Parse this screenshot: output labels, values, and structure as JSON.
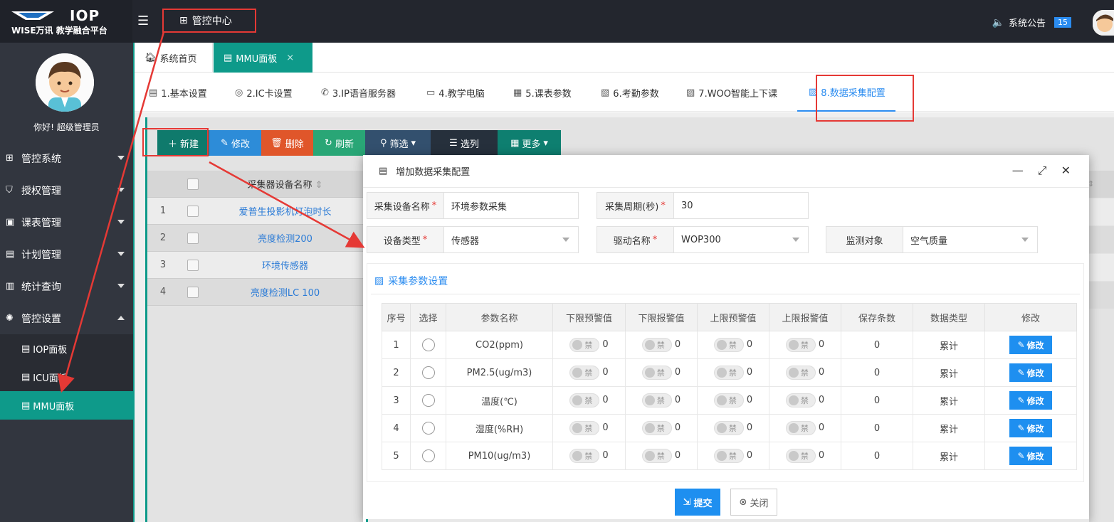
{
  "header": {
    "logo_title": "IOP",
    "logo_sub": "WISE万讯 教学融合平台",
    "center_label": "管控中心",
    "notice_label": "系统公告",
    "notice_count": "15"
  },
  "sidebar": {
    "greeting": "你好! 超级管理员",
    "items": [
      {
        "label": "管控系统"
      },
      {
        "label": "授权管理"
      },
      {
        "label": "课表管理"
      },
      {
        "label": "计划管理"
      },
      {
        "label": "统计查询"
      },
      {
        "label": "管控设置"
      }
    ],
    "subitems": [
      {
        "label": "IOP面板"
      },
      {
        "label": "ICU面板"
      },
      {
        "label": "MMU面板"
      }
    ]
  },
  "tabs": {
    "home": "系统首页",
    "mmu": "MMU面板",
    "close_glyph": "×"
  },
  "subtabs": [
    {
      "label": "1.基本设置"
    },
    {
      "label": "2.IC卡设置"
    },
    {
      "label": "3.IP语音服务器"
    },
    {
      "label": "4.教学电脑"
    },
    {
      "label": "5.课表参数"
    },
    {
      "label": "6.考勤参数"
    },
    {
      "label": "7.WOO智能上下课"
    },
    {
      "label": "8.数据采集配置"
    }
  ],
  "toolbar": {
    "new": "新建",
    "edit": "修改",
    "delete": "删除",
    "refresh": "刷新",
    "filter": "筛选",
    "columns": "选列",
    "more": "更多"
  },
  "grid": {
    "header_name": "采集器设备名称",
    "rows": [
      {
        "idx": "1",
        "name": "爱普生投影机灯泡时长"
      },
      {
        "idx": "2",
        "name": "亮度检测200"
      },
      {
        "idx": "3",
        "name": "环境传感器"
      },
      {
        "idx": "4",
        "name": "亮度检测LC 100"
      }
    ]
  },
  "modal": {
    "title": "增加数据采集配置",
    "fields": {
      "device_name_label": "采集设备名称",
      "device_name_value": "环境参数采集",
      "period_label": "采集周期(秒)",
      "period_value": "30",
      "device_type_label": "设备类型",
      "device_type_value": "传感器",
      "driver_label": "驱动名称",
      "driver_value": "WOP300",
      "target_label": "监测对象",
      "target_value": "空气质量"
    },
    "section_title": "采集参数设置",
    "columns": [
      "序号",
      "选择",
      "参数名称",
      "下限预警值",
      "下限报警值",
      "上限预警值",
      "上限报警值",
      "保存条数",
      "数据类型",
      "修改"
    ],
    "switch_text": "禁",
    "edit_label": "修改",
    "params": [
      {
        "idx": "1",
        "name": "CO2(ppm)",
        "ll_warn": "0",
        "ll_alarm": "0",
        "ul_warn": "0",
        "ul_alarm": "0",
        "keep": "0",
        "type": "累计"
      },
      {
        "idx": "2",
        "name": "PM2.5(ug/m3)",
        "ll_warn": "0",
        "ll_alarm": "0",
        "ul_warn": "0",
        "ul_alarm": "0",
        "keep": "0",
        "type": "累计"
      },
      {
        "idx": "3",
        "name": "温度(℃)",
        "ll_warn": "0",
        "ll_alarm": "0",
        "ul_warn": "0",
        "ul_alarm": "0",
        "keep": "0",
        "type": "累计"
      },
      {
        "idx": "4",
        "name": "湿度(%RH)",
        "ll_warn": "0",
        "ll_alarm": "0",
        "ul_warn": "0",
        "ul_alarm": "0",
        "keep": "0",
        "type": "累计"
      },
      {
        "idx": "5",
        "name": "PM10(ug/m3)",
        "ll_warn": "0",
        "ll_alarm": "0",
        "ul_warn": "0",
        "ul_alarm": "0",
        "keep": "0",
        "type": "累计"
      }
    ],
    "submit": "提交",
    "close": "关闭"
  },
  "colors": {
    "accent_teal": "#0e9a8a",
    "primary_blue": "#1e8ff0",
    "annotation_red": "#e53935"
  }
}
